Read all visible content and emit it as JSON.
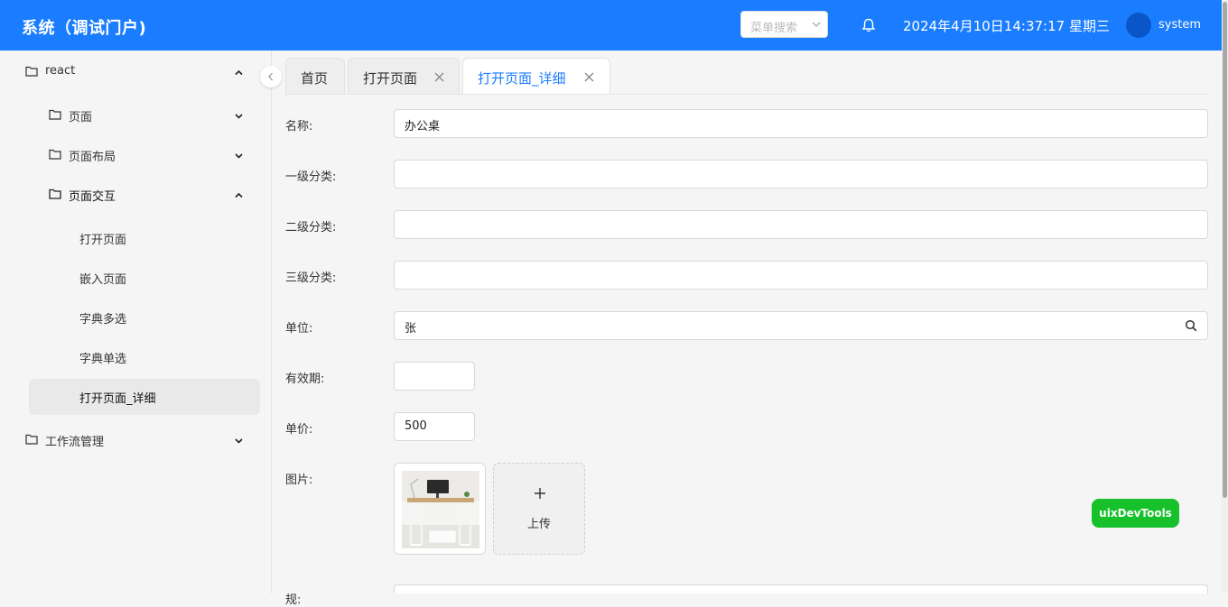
{
  "header": {
    "title": "系统（调试门户)",
    "menu_search_placeholder": "菜单搜索",
    "datetime": "2024年4月10日14:37:17 星期三",
    "username": "system",
    "colors": {
      "brand": "#1a7cff",
      "avatar": "#0a56c8"
    }
  },
  "sidebar": {
    "items": [
      {
        "label": "react",
        "icon": "folder-icon",
        "arrow": "chevron-up-icon"
      },
      {
        "label": "页面",
        "icon": "folder-icon",
        "arrow": "chevron-down-icon"
      },
      {
        "label": "页面布局",
        "icon": "folder-icon",
        "arrow": "chevron-down-icon"
      },
      {
        "label": "页面交互",
        "icon": "folder-icon",
        "arrow": "chevron-up-icon"
      },
      {
        "label": "打开页面"
      },
      {
        "label": "嵌入页面"
      },
      {
        "label": "字典多选"
      },
      {
        "label": "字典单选"
      },
      {
        "label": "打开页面_详细",
        "selected": true
      },
      {
        "label": "工作流管理",
        "icon": "folder-icon",
        "arrow": "chevron-down-icon"
      }
    ]
  },
  "tabs": [
    {
      "label": "首页",
      "closable": false
    },
    {
      "label": "打开页面",
      "closable": true
    },
    {
      "label": "打开页面_详细",
      "closable": true,
      "active": true
    }
  ],
  "form": {
    "name": {
      "label": "名称:",
      "value": "办公桌"
    },
    "category1": {
      "label": "一级分类:",
      "value": ""
    },
    "category2": {
      "label": "二级分类:",
      "value": ""
    },
    "category3": {
      "label": "三级分类:",
      "value": ""
    },
    "unit": {
      "label": "单位:",
      "value": "张"
    },
    "validity": {
      "label": "有效期:",
      "value": ""
    },
    "price": {
      "label": "单价:",
      "value": "500"
    },
    "image": {
      "label": "图片:",
      "upload_label": "上传"
    },
    "next": {
      "label": "规:"
    }
  },
  "devtools_label": "uixDevTools",
  "status_colors": {
    "devtools": "#16c12b"
  }
}
